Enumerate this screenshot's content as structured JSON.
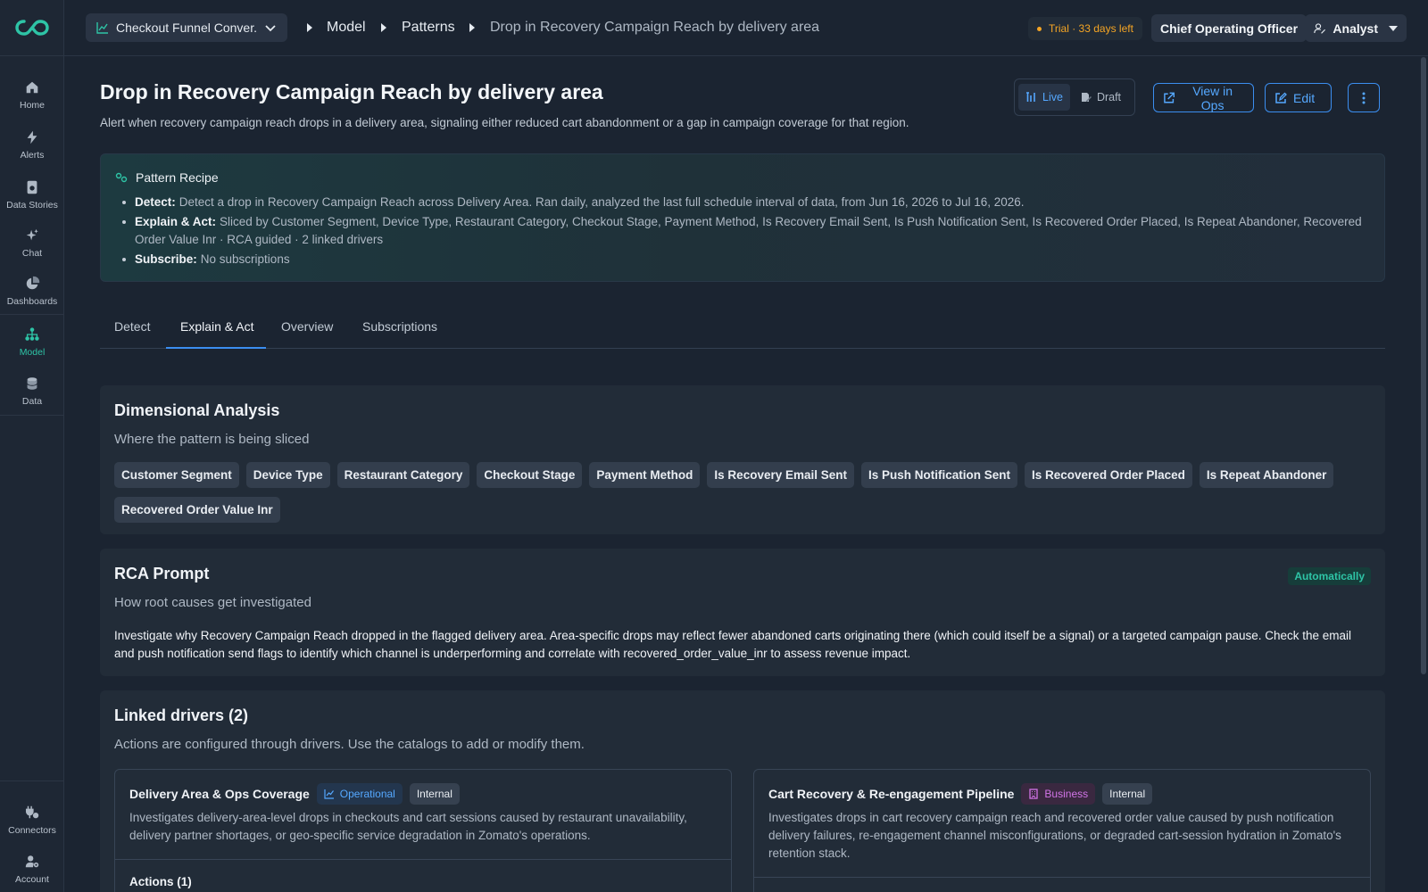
{
  "sidebar": {
    "items": [
      {
        "label": "Home",
        "icon": "home-icon"
      },
      {
        "label": "Alerts",
        "icon": "bolt-icon"
      },
      {
        "label": "Data Stories",
        "icon": "data-stories-icon"
      },
      {
        "label": "Chat",
        "icon": "sparkle-icon"
      },
      {
        "label": "Dashboards",
        "icon": "pie-chart-icon"
      },
      {
        "label": "Model",
        "icon": "hierarchy-icon",
        "active": true
      },
      {
        "label": "Data",
        "icon": "database-icon"
      }
    ],
    "bottom": [
      {
        "label": "Connectors",
        "icon": "plug-icon"
      },
      {
        "label": "Account",
        "icon": "user-settings-icon"
      }
    ]
  },
  "topbar": {
    "metric_select": "Checkout Funnel Conver...",
    "breadcrumbs": [
      "Model",
      "Patterns",
      "Drop in Recovery Campaign Reach by delivery area"
    ],
    "trial": "Trial · 33 days left",
    "persona": "Chief Operating Officer",
    "role": "Analyst"
  },
  "header": {
    "title": "Drop in Recovery Campaign Reach by delivery area",
    "description": "Alert when recovery campaign reach drops in a delivery area, signaling either reduced cart abandonment or a gap in campaign coverage for that region.",
    "mode_live": "Live",
    "mode_draft": "Draft",
    "view_in_ops": "View in Ops",
    "edit": "Edit"
  },
  "recipe": {
    "title": "Pattern Recipe",
    "detect_label": "Detect:",
    "detect": "Detect a drop in Recovery Campaign Reach across Delivery Area. Ran daily, analyzed the last full schedule interval of data, from Jun 16, 2026 to Jul 16, 2026.",
    "explain_label": "Explain & Act:",
    "explain": "Sliced by Customer Segment, Device Type, Restaurant Category, Checkout Stage, Payment Method, Is Recovery Email Sent, Is Push Notification Sent, Is Recovered Order Placed, Is Repeat Abandoner, Recovered Order Value Inr · RCA guided · 2 linked drivers",
    "subscribe_label": "Subscribe:",
    "subscribe": "No subscriptions"
  },
  "tabs": [
    "Detect",
    "Explain & Act",
    "Overview",
    "Subscriptions"
  ],
  "dimensional": {
    "title": "Dimensional Analysis",
    "subtitle": "Where the pattern is being sliced",
    "chips": [
      "Customer Segment",
      "Device Type",
      "Restaurant Category",
      "Checkout Stage",
      "Payment Method",
      "Is Recovery Email Sent",
      "Is Push Notification Sent",
      "Is Recovered Order Placed",
      "Is Repeat Abandoner",
      "Recovered Order Value Inr"
    ]
  },
  "rca": {
    "title": "RCA Prompt",
    "subtitle": "How root causes get investigated",
    "badge": "Automatically",
    "text": "Investigate why Recovery Campaign Reach dropped in the flagged delivery area. Area-specific drops may reflect fewer abandoned carts originating there (which could itself be a signal) or a targeted campaign pause. Check the email and push notification send flags to identify which channel is underperforming and correlate with recovered_order_value_inr to assess revenue impact."
  },
  "drivers": {
    "title": "Linked drivers (2)",
    "subtitle": "Actions are configured through drivers. Use the catalogs to add or modify them.",
    "items": [
      {
        "name": "Delivery Area & Ops Coverage",
        "type": "Operational",
        "scope": "Internal",
        "desc": "Investigates delivery-area-level drops in checkouts and cart sessions caused by restaurant unavailability, delivery partner shortages, or geo-specific service degradation in Zomato's operations.",
        "actions": "Actions (1)"
      },
      {
        "name": "Cart Recovery & Re-engagement Pipeline",
        "type": "Business",
        "scope": "Internal",
        "desc": "Investigates drops in cart recovery campaign reach and recovered order value caused by push notification delivery failures, re-engagement channel misconfigurations, or degraded cart-session hydration in Zomato's retention stack."
      }
    ]
  },
  "colors": {
    "accent_teal": "#2ec4a6",
    "accent_blue": "#3b8ef0",
    "trial_orange": "#f5a524",
    "business_pink": "#d174e6"
  }
}
